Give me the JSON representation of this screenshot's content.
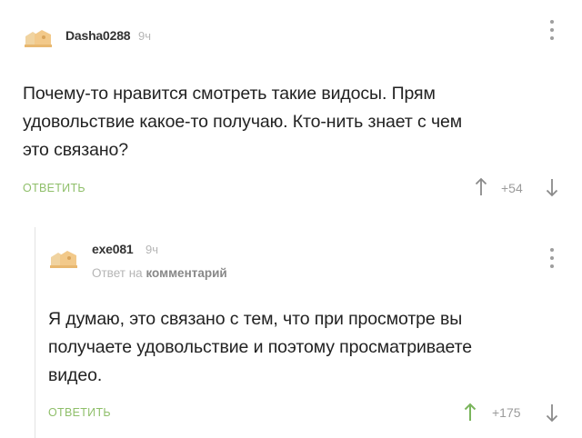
{
  "comments": [
    {
      "username": "Dasha0288",
      "time": "9ч",
      "text_lines": [
        "Почему-то нравится смотреть такие видосы. Прям",
        "удовольствие какое-то получаю. Кто-нить знает с чем",
        "это связано?"
      ],
      "reply_label": "ОТВЕТИТЬ",
      "rating": "+54"
    },
    {
      "username": "exe081",
      "time": "9ч",
      "reply_to_prefix": "Ответ на",
      "reply_to_target": "комментарий",
      "text_lines": [
        "Я думаю, это связано с тем, что при просмотре вы",
        "получаете удовольствие и поэтому просматриваете",
        "видео."
      ],
      "reply_label": "ОТВЕТИТЬ",
      "rating": "+175"
    }
  ],
  "colors": {
    "reply_green": "#8fbf6a",
    "upvote_active": "#7ab55c",
    "muted": "#9b9b9b"
  },
  "icons": {
    "avatar": "default-avatar-icon",
    "more": "more-vertical-icon",
    "upvote": "arrow-up-icon",
    "downvote": "arrow-down-icon"
  }
}
